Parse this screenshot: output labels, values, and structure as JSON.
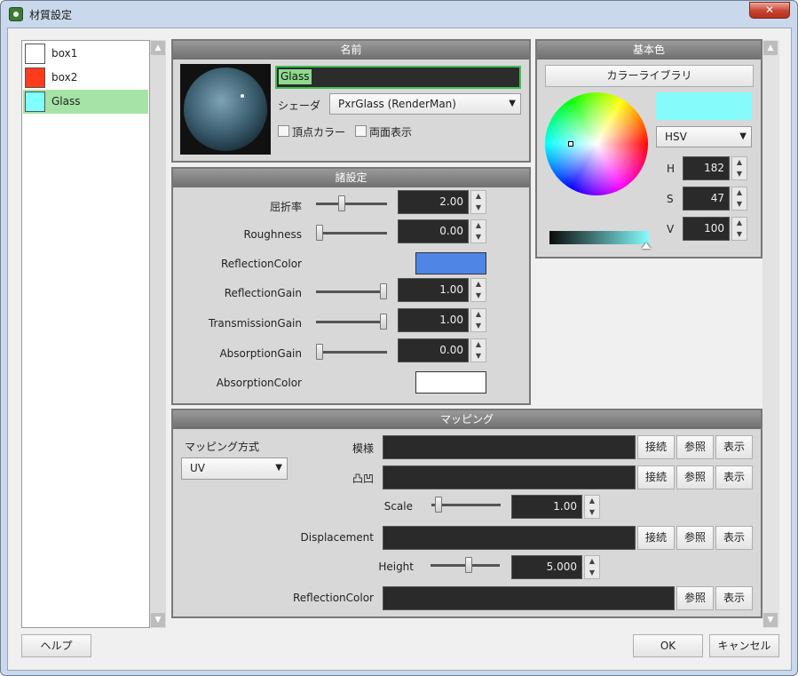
{
  "window": {
    "title": "材質設定",
    "close": "✕"
  },
  "materials": [
    {
      "name": "box1",
      "color": "#ffffff"
    },
    {
      "name": "box2",
      "color": "#ff3b1e"
    },
    {
      "name": "Glass",
      "color": "#7fffff"
    }
  ],
  "name_panel": {
    "header": "名前",
    "name_value": "Glass",
    "shader_label": "シェーダ",
    "shader_value": "PxrGlass (RenderMan)",
    "vertex_color": "頂点カラー",
    "double_sided": "両面表示"
  },
  "settings": {
    "header": "諸設定",
    "ior_label": "屈折率",
    "ior_value": "2.00",
    "roughness_label": "Roughness",
    "roughness_value": "0.00",
    "refl_color_label": "ReflectionColor",
    "refl_color": "#4f86e6",
    "refl_gain_label": "ReflectionGain",
    "refl_gain_value": "1.00",
    "trans_gain_label": "TransmissionGain",
    "trans_gain_value": "1.00",
    "abs_gain_label": "AbsorptionGain",
    "abs_gain_value": "0.00",
    "abs_color_label": "AbsorptionColor",
    "abs_color": "#ffffff"
  },
  "basecolor": {
    "header": "基本色",
    "library": "カラーライブラリ",
    "swatch": "#85fbfb",
    "mode": "HSV",
    "h_label": "H",
    "h": "182",
    "s_label": "S",
    "s": "47",
    "v_label": "V",
    "v": "100"
  },
  "mapping": {
    "header": "マッピング",
    "method_label": "マッピング方式",
    "method_value": "UV",
    "pattern_label": "模様",
    "bump_label": "凸凹",
    "scale_label": "Scale",
    "scale_value": "1.00",
    "disp_label": "Displacement",
    "height_label": "Height",
    "height_value": "5.000",
    "refl_label": "ReflectionColor",
    "connect": "接続",
    "browse": "参照",
    "show": "表示"
  },
  "footer": {
    "help": "ヘルプ",
    "ok": "OK",
    "cancel": "キャンセル"
  }
}
